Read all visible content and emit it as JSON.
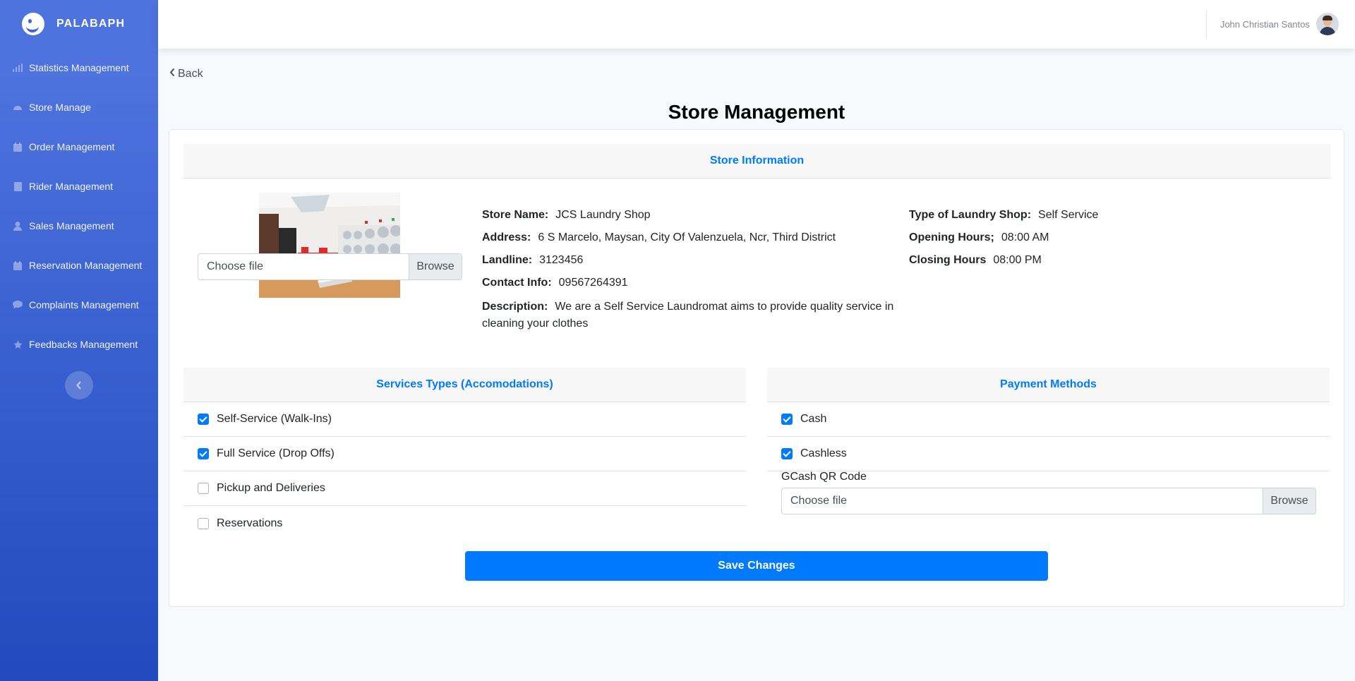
{
  "app": {
    "brand": "PALABAPH"
  },
  "sidebar": {
    "items": [
      {
        "label": "Statistics Management",
        "icon": "bar-chart-icon"
      },
      {
        "label": "Store Manage",
        "icon": "gauge-icon"
      },
      {
        "label": "Order Management",
        "icon": "calendar-icon"
      },
      {
        "label": "Rider Management",
        "icon": "building-icon"
      },
      {
        "label": "Sales Management",
        "icon": "user-icon"
      },
      {
        "label": "Reservation Management",
        "icon": "calendar-icon"
      },
      {
        "label": "Complaints Management",
        "icon": "comment-icon"
      },
      {
        "label": "Feedbacks Management",
        "icon": "star-icon"
      }
    ]
  },
  "topbar": {
    "user_name": "John Christian Santos"
  },
  "page": {
    "back_label": "Back",
    "title": "Store Management"
  },
  "store_info": {
    "header": "Store Information",
    "file_input": {
      "placeholder": "Choose file",
      "button": "Browse"
    },
    "fields": {
      "store_name": {
        "label": "Store Name:",
        "value": "JCS Laundry Shop"
      },
      "address": {
        "label": "Address:",
        "value": "6 S Marcelo, Maysan, City Of Valenzuela, Ncr, Third District"
      },
      "landline": {
        "label": "Landline:",
        "value": "3123456"
      },
      "contact": {
        "label": "Contact Info:",
        "value": "09567264391"
      },
      "description": {
        "label": "Description:",
        "value": "We are a Self Service Laundromat aims to provide quality service in cleaning your clothes"
      },
      "type": {
        "label": "Type of Laundry Shop:",
        "value": "Self Service"
      },
      "opening": {
        "label": "Opening Hours;",
        "value": "08:00 AM"
      },
      "closing": {
        "label": "Closing Hours",
        "value": "08:00 PM"
      }
    }
  },
  "services": {
    "header": "Services Types (Accomodations)",
    "items": [
      {
        "label": "Self-Service (Walk-Ins)",
        "checked": true
      },
      {
        "label": "Full Service (Drop Offs)",
        "checked": true
      },
      {
        "label": "Pickup and Deliveries",
        "checked": false
      },
      {
        "label": "Reservations",
        "checked": false
      }
    ]
  },
  "payments": {
    "header": "Payment Methods",
    "items": [
      {
        "label": "Cash",
        "checked": true
      },
      {
        "label": "Cashless",
        "checked": true
      }
    ],
    "gcash_label": "GCash QR Code",
    "file_input": {
      "placeholder": "Choose file",
      "button": "Browse"
    }
  },
  "actions": {
    "save_label": "Save Changes"
  },
  "colors": {
    "primary": "#007bff",
    "sidebar_start": "#4e73df",
    "sidebar_end": "#224abe"
  }
}
